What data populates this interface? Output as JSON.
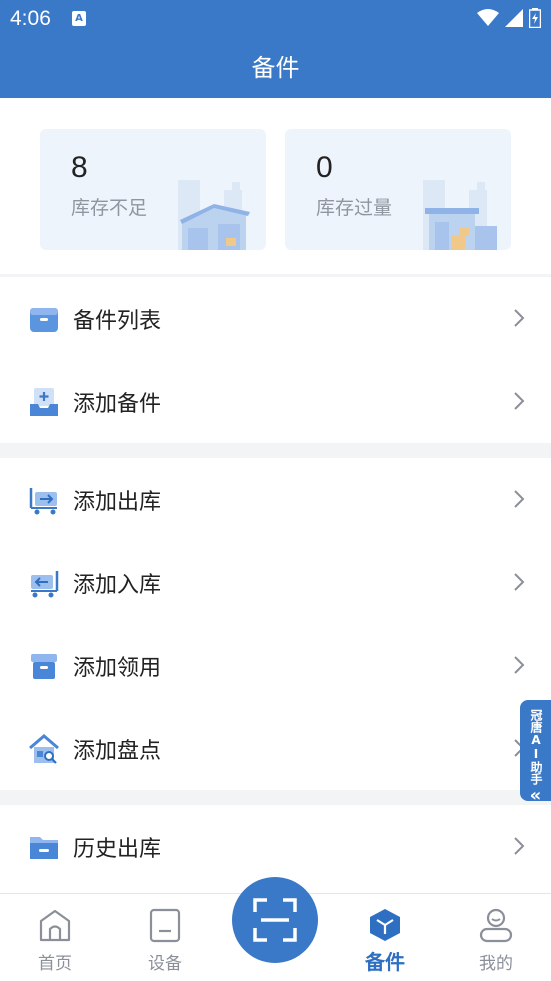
{
  "status": {
    "time": "4:06",
    "a_glyph": "A"
  },
  "header": {
    "title": "备件"
  },
  "stats": [
    {
      "value": "8",
      "label": "库存不足"
    },
    {
      "value": "0",
      "label": "库存过量"
    }
  ],
  "menu": {
    "group1": [
      "备件列表",
      "添加备件"
    ],
    "group2": [
      "添加出库",
      "添加入库",
      "添加领用",
      "添加盘点"
    ],
    "group3": [
      "历史出库"
    ]
  },
  "ai_tab": {
    "label": "冠唐AI助手",
    "chevron": "«"
  },
  "tabbar": {
    "tabs": [
      {
        "label": "首页",
        "icon": "home-icon"
      },
      {
        "label": "设备",
        "icon": "device-icon"
      },
      {
        "label": "备件",
        "icon": "box-icon",
        "active": true
      },
      {
        "label": "我的",
        "icon": "user-icon"
      }
    ],
    "scan_icon": "scan-icon"
  },
  "colors": {
    "primary": "#3a78c8",
    "active_tab": "#2f6fc2",
    "card_bg": "#eef4fc"
  }
}
